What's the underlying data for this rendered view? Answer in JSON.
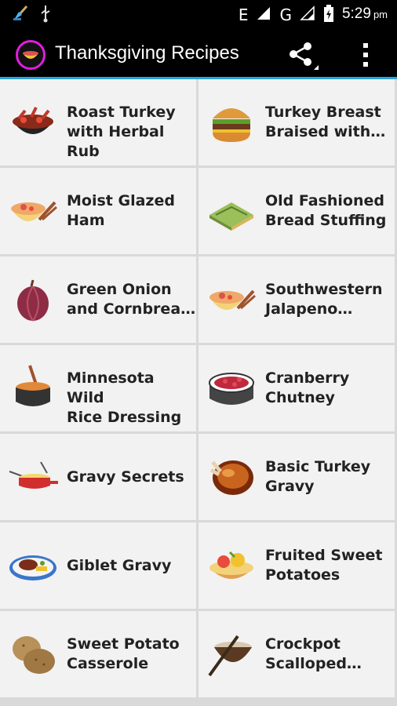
{
  "status_bar": {
    "network_label": "E",
    "network_label_2": "G",
    "time": "5:29",
    "time_suffix": "pm"
  },
  "app_bar": {
    "title": "Thanksgiving Recipes",
    "share_icon": "share-icon",
    "overflow_icon": "more-vert-icon"
  },
  "recipes": [
    {
      "label": "Roast Turkey\nwith Herbal Rub",
      "icon": "turkey-bowl-icon"
    },
    {
      "label": "Turkey Breast\nBraised with…",
      "icon": "burger-icon"
    },
    {
      "label": "Moist Glazed\nHam",
      "icon": "soup-bowl-icon"
    },
    {
      "label": "Old Fashioned\nBread Stuffing",
      "icon": "bread-stuffing-icon"
    },
    {
      "label": "Green Onion\nand Cornbrea…",
      "icon": "red-onion-icon"
    },
    {
      "label": "Southwestern\nJalapeno…",
      "icon": "soup-bowl-icon"
    },
    {
      "label": "Minnesota Wild\nRice Dressing",
      "icon": "cooking-pot-icon"
    },
    {
      "label": "Cranberry\nChutney",
      "icon": "cranberry-bowl-icon"
    },
    {
      "label": "Gravy Secrets",
      "icon": "fondue-pot-icon"
    },
    {
      "label": "Basic Turkey\nGravy",
      "icon": "roast-turkey-icon"
    },
    {
      "label": "Giblet Gravy",
      "icon": "dinner-plate-icon"
    },
    {
      "label": "Fruited Sweet\nPotatoes",
      "icon": "fruit-tart-icon"
    },
    {
      "label": "Sweet Potato\nCasserole",
      "icon": "potatoes-icon"
    },
    {
      "label": "Crockpot\nScalloped…",
      "icon": "mortar-pestle-icon"
    }
  ]
}
